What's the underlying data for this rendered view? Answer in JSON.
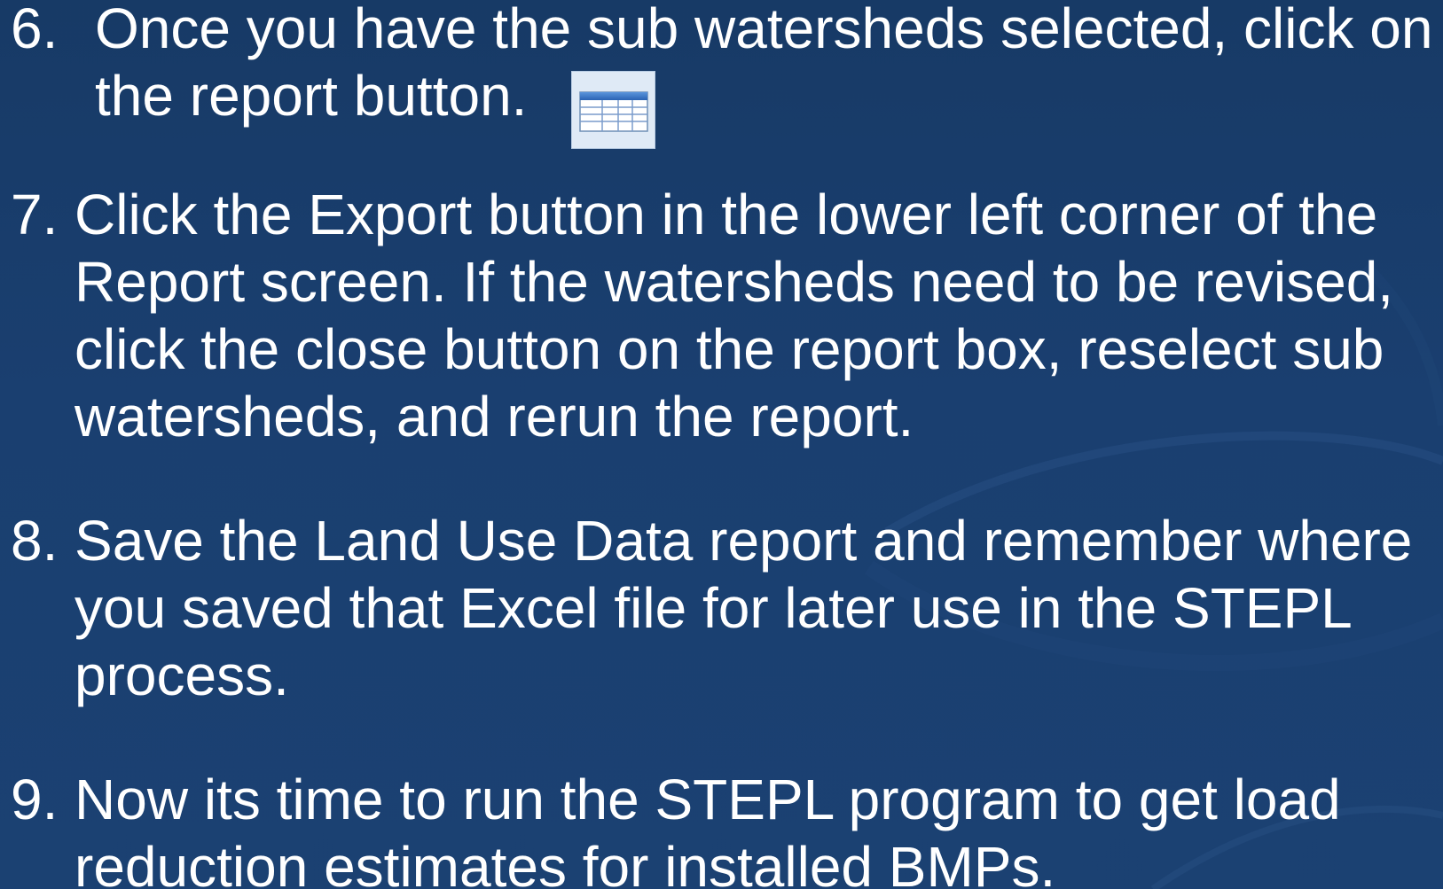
{
  "steps": [
    {
      "number": "6.",
      "lines": [
        "Once you have the sub watersheds selected, click on",
        "the report button."
      ]
    },
    {
      "number": "7.",
      "lines": [
        "Click the Export button in the lower left corner of the",
        "Report screen. If the watersheds need to be revised,",
        "click the close button on the report box, reselect sub",
        "watersheds, and rerun the report."
      ]
    },
    {
      "number": "8.",
      "lines": [
        "Save the Land Use Data report and remember where",
        "you saved that Excel file for later use in the STEPL",
        "process."
      ]
    },
    {
      "number": "9.",
      "lines": [
        "Now its time to run the STEPL program to get load",
        "reduction estimates for installed BMPs."
      ]
    }
  ],
  "icons": {
    "report_button": "table-report-icon"
  },
  "colors": {
    "background": "#1a3d6e",
    "text": "#ffffff",
    "icon_background": "#dfeaf6",
    "icon_header": "#2f6fc0"
  }
}
